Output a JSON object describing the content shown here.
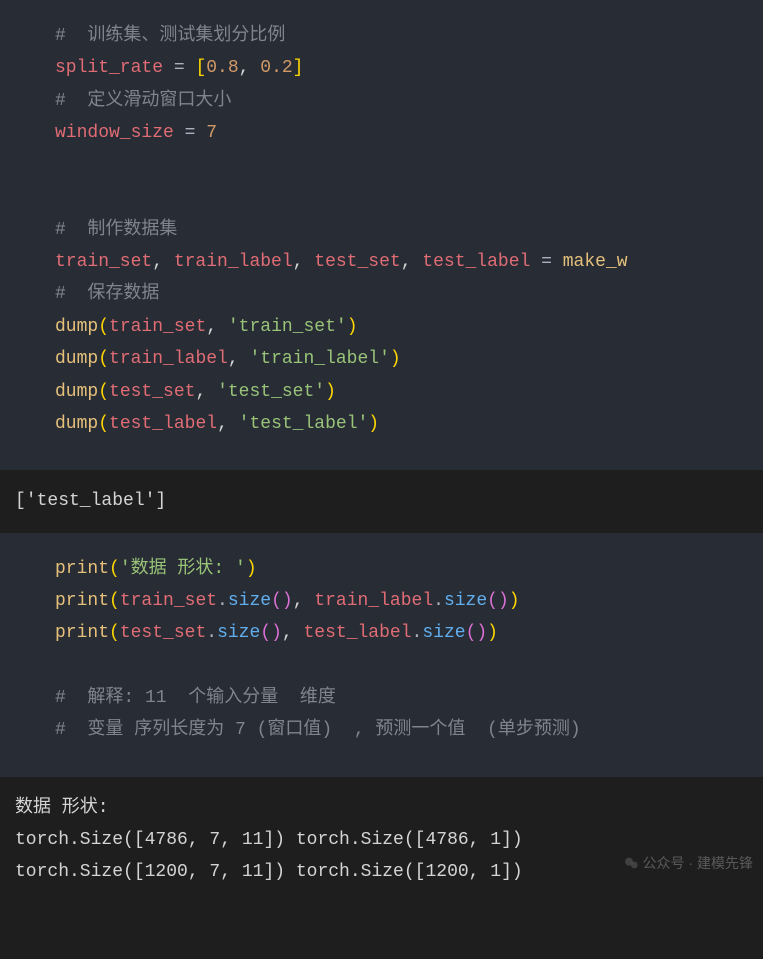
{
  "code1": {
    "c1": "#  训练集、测试集划分比例",
    "l2_var": "split_rate",
    "l2_eq": " = ",
    "l2_b1": "[",
    "l2_n1": "0.8",
    "l2_comma": ", ",
    "l2_n2": "0.2",
    "l2_b2": "]",
    "c3": "#  定义滑动窗口大小",
    "l4_var": "window_size",
    "l4_eq": " = ",
    "l4_n": "7",
    "c5": "#  制作数据集",
    "l6_a": "train_set",
    "l6_b": "train_label",
    "l6_c": "test_set",
    "l6_d": "test_label",
    "l6_eq": " = ",
    "l6_fn": "make_w",
    "c7": "#  保存数据",
    "d_fn": "dump",
    "d1_arg": "train_set",
    "d1_str": "'train_set'",
    "d2_arg": "train_label",
    "d2_str": "'train_label'",
    "d3_arg": "test_set",
    "d3_str": "'test_set'",
    "d4_arg": "test_label",
    "d4_str": "'test_label'"
  },
  "out1": "['test_label']",
  "code2": {
    "p_fn": "print",
    "p1_str": "'数据 形状: '",
    "p2_a": "train_set",
    "p2_b": "train_label",
    "p3_a": "test_set",
    "p3_b": "test_label",
    "size": "size",
    "c1": "#  解释: 11  个输入分量  维度",
    "c2": "#  变量 序列长度为 7 (窗口值)  , 预测一个值  (单步预测)"
  },
  "out2": {
    "l1": "数据 形状:",
    "l2": "torch.Size([4786, 7, 11]) torch.Size([4786, 1])",
    "l3": "torch.Size([1200, 7, 11]) torch.Size([1200, 1])"
  },
  "watermark": "公众号 · 建模先锋"
}
